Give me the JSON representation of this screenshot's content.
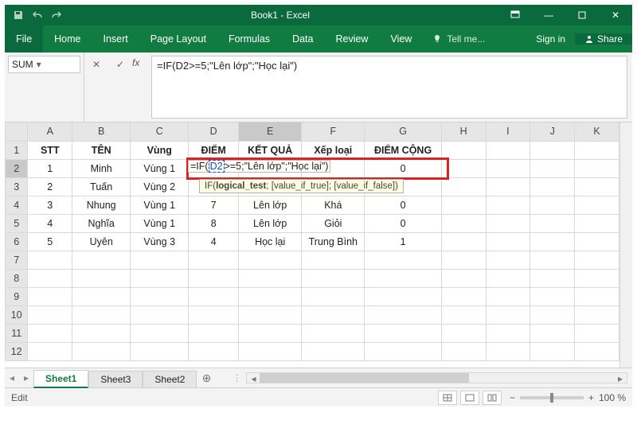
{
  "titlebar": {
    "title": "Book1 - Excel"
  },
  "ribbon": {
    "tabs": [
      "File",
      "Home",
      "Insert",
      "Page Layout",
      "Formulas",
      "Data",
      "Review",
      "View"
    ],
    "tellme": "Tell me...",
    "signin": "Sign in",
    "share": "Share"
  },
  "formula": {
    "namebox": "SUM",
    "fx": "fx",
    "text": "=IF(D2>=5;\"Lên lớp\";\"Học lại\")"
  },
  "columns": [
    "A",
    "B",
    "C",
    "D",
    "E",
    "F",
    "G",
    "H",
    "I",
    "J",
    "K"
  ],
  "headerRow": [
    "STT",
    "TÊN",
    "Vùng",
    "ĐIỂM",
    "KẾT QUẢ",
    "Xếp loại",
    "ĐIỂM CỘNG",
    "",
    "",
    "",
    ""
  ],
  "rows": [
    {
      "n": "1",
      "cells": [
        "1",
        "Minh",
        "Vùng 1",
        "",
        "",
        "",
        "0",
        "",
        "",
        "",
        ""
      ]
    },
    {
      "n": "2",
      "cells": [
        "2",
        "Tuấn",
        "Vùng 2",
        "",
        "",
        "",
        "",
        "",
        "",
        "",
        ""
      ]
    },
    {
      "n": "3",
      "cells": [
        "3",
        "Nhung",
        "Vùng 1",
        "7",
        "Lên lớp",
        "Khá",
        "0",
        "",
        "",
        "",
        ""
      ]
    },
    {
      "n": "4",
      "cells": [
        "4",
        "Nghĩa",
        "Vùng 1",
        "8",
        "Lên lớp",
        "Giỏi",
        "0",
        "",
        "",
        "",
        ""
      ]
    },
    {
      "n": "5",
      "cells": [
        "5",
        "Uyên",
        "Vùng 3",
        "4",
        "Học lại",
        "Trung Bình",
        "1",
        "",
        "",
        "",
        ""
      ]
    },
    {
      "n": "6",
      "cells": [
        "",
        "",
        "",
        "",
        "",
        "",
        "",
        "",
        "",
        "",
        ""
      ]
    },
    {
      "n": "7",
      "cells": [
        "",
        "",
        "",
        "",
        "",
        "",
        "",
        "",
        "",
        "",
        ""
      ]
    },
    {
      "n": "8",
      "cells": [
        "",
        "",
        "",
        "",
        "",
        "",
        "",
        "",
        "",
        "",
        ""
      ]
    },
    {
      "n": "9",
      "cells": [
        "",
        "",
        "",
        "",
        "",
        "",
        "",
        "",
        "",
        "",
        ""
      ]
    },
    {
      "n": "10",
      "cells": [
        "",
        "",
        "",
        "",
        "",
        "",
        "",
        "",
        "",
        "",
        ""
      ]
    },
    {
      "n": "11",
      "cells": [
        "",
        "",
        "",
        "",
        "",
        "",
        "",
        "",
        "",
        "",
        ""
      ]
    }
  ],
  "editCell": {
    "prefix": "=IF(",
    "ref": "D2",
    "suffix": ">=5;\"Lên lớp\";\"Học lại\")"
  },
  "tooltip": {
    "fn": "IF",
    "arg1": "logical_test",
    "arg2": "[value_if_true]",
    "arg3": "[value_if_false]"
  },
  "sheetTabs": [
    "Sheet1",
    "Sheet3",
    "Sheet2"
  ],
  "status": {
    "mode": "Edit",
    "zoom": "100 %"
  }
}
